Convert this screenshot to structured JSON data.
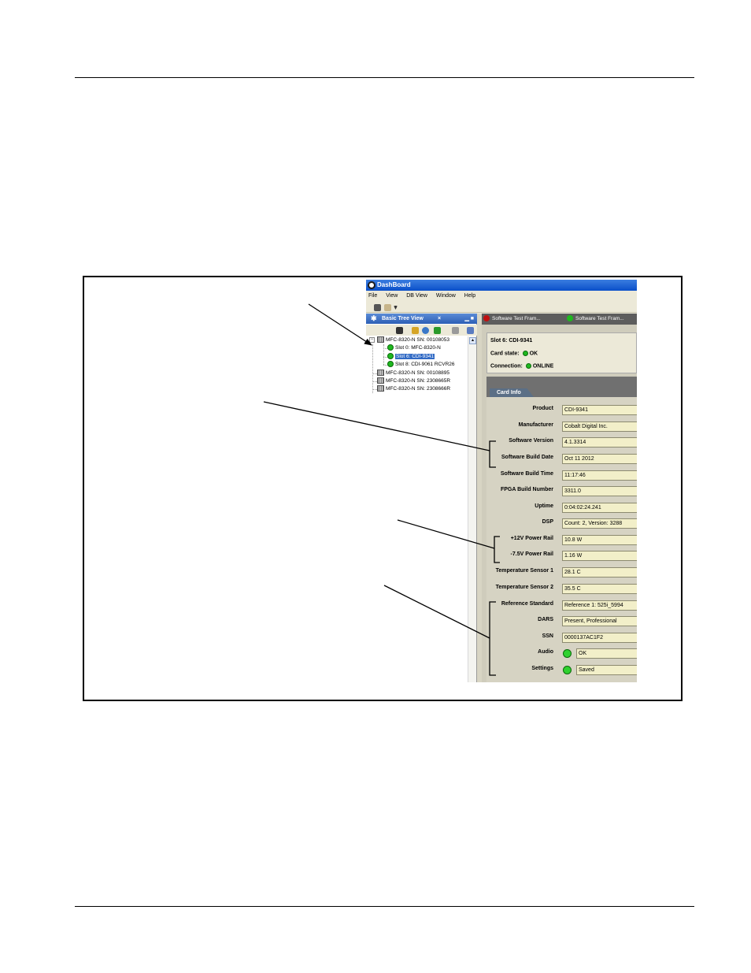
{
  "app": {
    "title": "DashBoard",
    "menu": [
      "File",
      "View",
      "DB View",
      "Window",
      "Help"
    ]
  },
  "tree_panel": {
    "tab_label": "Basic Tree View",
    "close_symbol": "×",
    "nodes": [
      {
        "label": "MFC-8320-N SN: 00108053",
        "kind": "frame",
        "expanded": true
      },
      {
        "label": "Slot 0: MFC-8320-N",
        "kind": "card",
        "status_color": "#1fb81f"
      },
      {
        "label": "Slot 6: CDI-9341",
        "kind": "card",
        "status_color": "#1fb81f",
        "selected": true
      },
      {
        "label": "Slot 8: CDI-9061 RCVR26",
        "kind": "card",
        "status_color": "#1fb81f"
      },
      {
        "label": "MFC-8320-N SN: 00108895",
        "kind": "frame"
      },
      {
        "label": "MFC-8320-N SN: 2308665R",
        "kind": "frame"
      },
      {
        "label": "MFC-8320-N SN: 2308666R",
        "kind": "frame"
      }
    ]
  },
  "editor_tabs": [
    {
      "label": "Software Test Fram...",
      "status_color": "#c01010"
    },
    {
      "label": "Software Test Fram...",
      "status_color": "#1fb81f"
    }
  ],
  "status": {
    "slot_title": "Slot 6: CDI-9341",
    "card_state_label": "Card state:",
    "card_state_value": "OK",
    "connection_label": "Connection:",
    "connection_value": "ONLINE"
  },
  "card_info": {
    "tab_label": "Card Info",
    "fields": [
      {
        "label": "Product",
        "value": "CDI-9341"
      },
      {
        "label": "Manufacturer",
        "value": "Cobalt Digital Inc."
      },
      {
        "label": "Software Version",
        "value": "4.1.3314"
      },
      {
        "label": "Software Build Date",
        "value": "Oct 11 2012"
      },
      {
        "label": "Software Build Time",
        "value": "11:17:46"
      },
      {
        "label": "FPGA Build Number",
        "value": "3311.0"
      },
      {
        "label": "Uptime",
        "value": "0:04:02:24.241"
      },
      {
        "label": "DSP",
        "value": "Count: 2, Version: 3288"
      },
      {
        "label": "+12V Power Rail",
        "value": "10.8 W"
      },
      {
        "label": "-7.5V Power Rail",
        "value": "1.16 W"
      },
      {
        "label": "Temperature Sensor 1",
        "value": "28.1 C"
      },
      {
        "label": "Temperature Sensor 2",
        "value": "35.5 C"
      },
      {
        "label": "Reference Standard",
        "value": "Reference 1: 525i_5994"
      },
      {
        "label": "DARS",
        "value": "Present, Professional"
      },
      {
        "label": "SSN",
        "value": "0000137AC1F2"
      },
      {
        "label": "Audio",
        "value": "OK",
        "led_color": "#2fd12f"
      },
      {
        "label": "Settings",
        "value": "Saved",
        "led_color": "#2fd12f"
      }
    ]
  }
}
